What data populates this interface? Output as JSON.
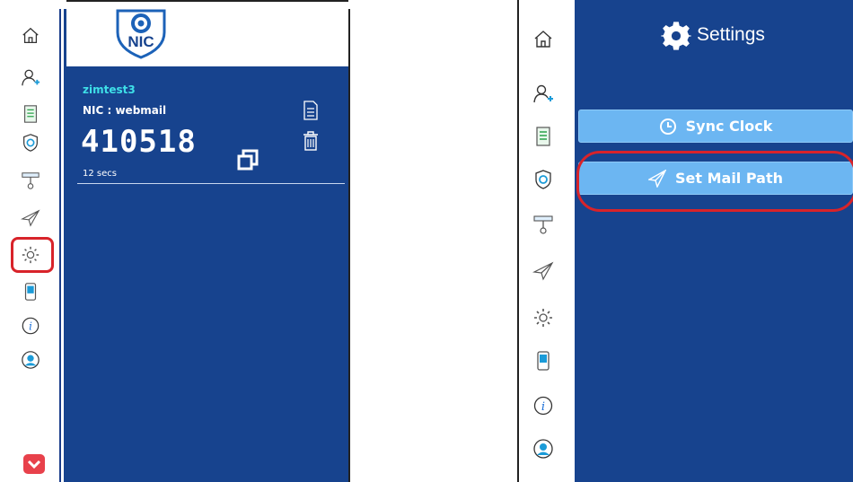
{
  "left_panel": {
    "account": {
      "username": "zimtest3",
      "title": "NIC : webmail",
      "otp": "410518",
      "timer": "12 secs"
    },
    "logo": {
      "text": "NIC"
    },
    "sidebar": {
      "items": [
        {
          "icon": "home-icon"
        },
        {
          "icon": "add-user-icon"
        },
        {
          "icon": "document-list-icon"
        },
        {
          "icon": "shield-sync-icon"
        },
        {
          "icon": "usb-key-icon"
        },
        {
          "icon": "send-icon"
        },
        {
          "icon": "gear-icon",
          "highlighted": true
        },
        {
          "icon": "mobile-icon"
        },
        {
          "icon": "info-icon"
        },
        {
          "icon": "profile-icon"
        }
      ]
    },
    "colors": {
      "panel": "#17438e",
      "accent": "#3ee0e8",
      "highlight": "#d8232a",
      "pocket": "#e8414b"
    }
  },
  "right_panel": {
    "header": {
      "title": "Settings"
    },
    "buttons": {
      "sync_clock": "Sync Clock",
      "set_mail_path": "Set Mail Path"
    },
    "sidebar": {
      "items": [
        {
          "icon": "home-icon"
        },
        {
          "icon": "add-user-icon"
        },
        {
          "icon": "document-list-icon"
        },
        {
          "icon": "shield-sync-icon"
        },
        {
          "icon": "usb-key-icon"
        },
        {
          "icon": "send-icon"
        },
        {
          "icon": "gear-icon"
        },
        {
          "icon": "mobile-icon"
        },
        {
          "icon": "info-icon"
        },
        {
          "icon": "profile-icon"
        }
      ]
    },
    "colors": {
      "button": "#6cb6f2",
      "highlight": "#d8232a"
    }
  }
}
